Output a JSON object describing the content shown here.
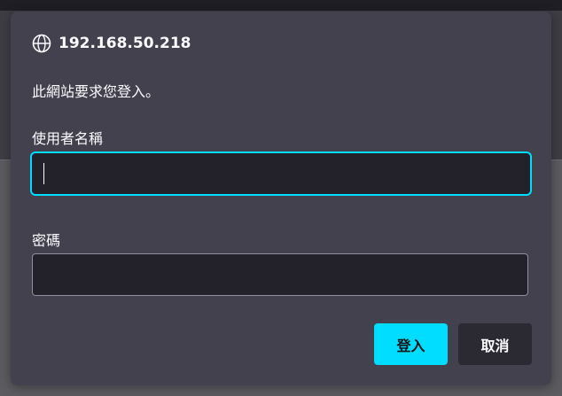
{
  "dialog": {
    "host": "192.168.50.218",
    "host_icon": "globe-icon",
    "message": "此網站要求您登入。",
    "username_label": "使用者名稱",
    "username_value": "",
    "password_label": "密碼",
    "password_value": "",
    "login_button": "登入",
    "cancel_button": "取消"
  },
  "colors": {
    "accent": "#00ddff",
    "dialog_bg": "#42414d",
    "input_bg": "#23222b",
    "text": "#fbfbfe"
  }
}
